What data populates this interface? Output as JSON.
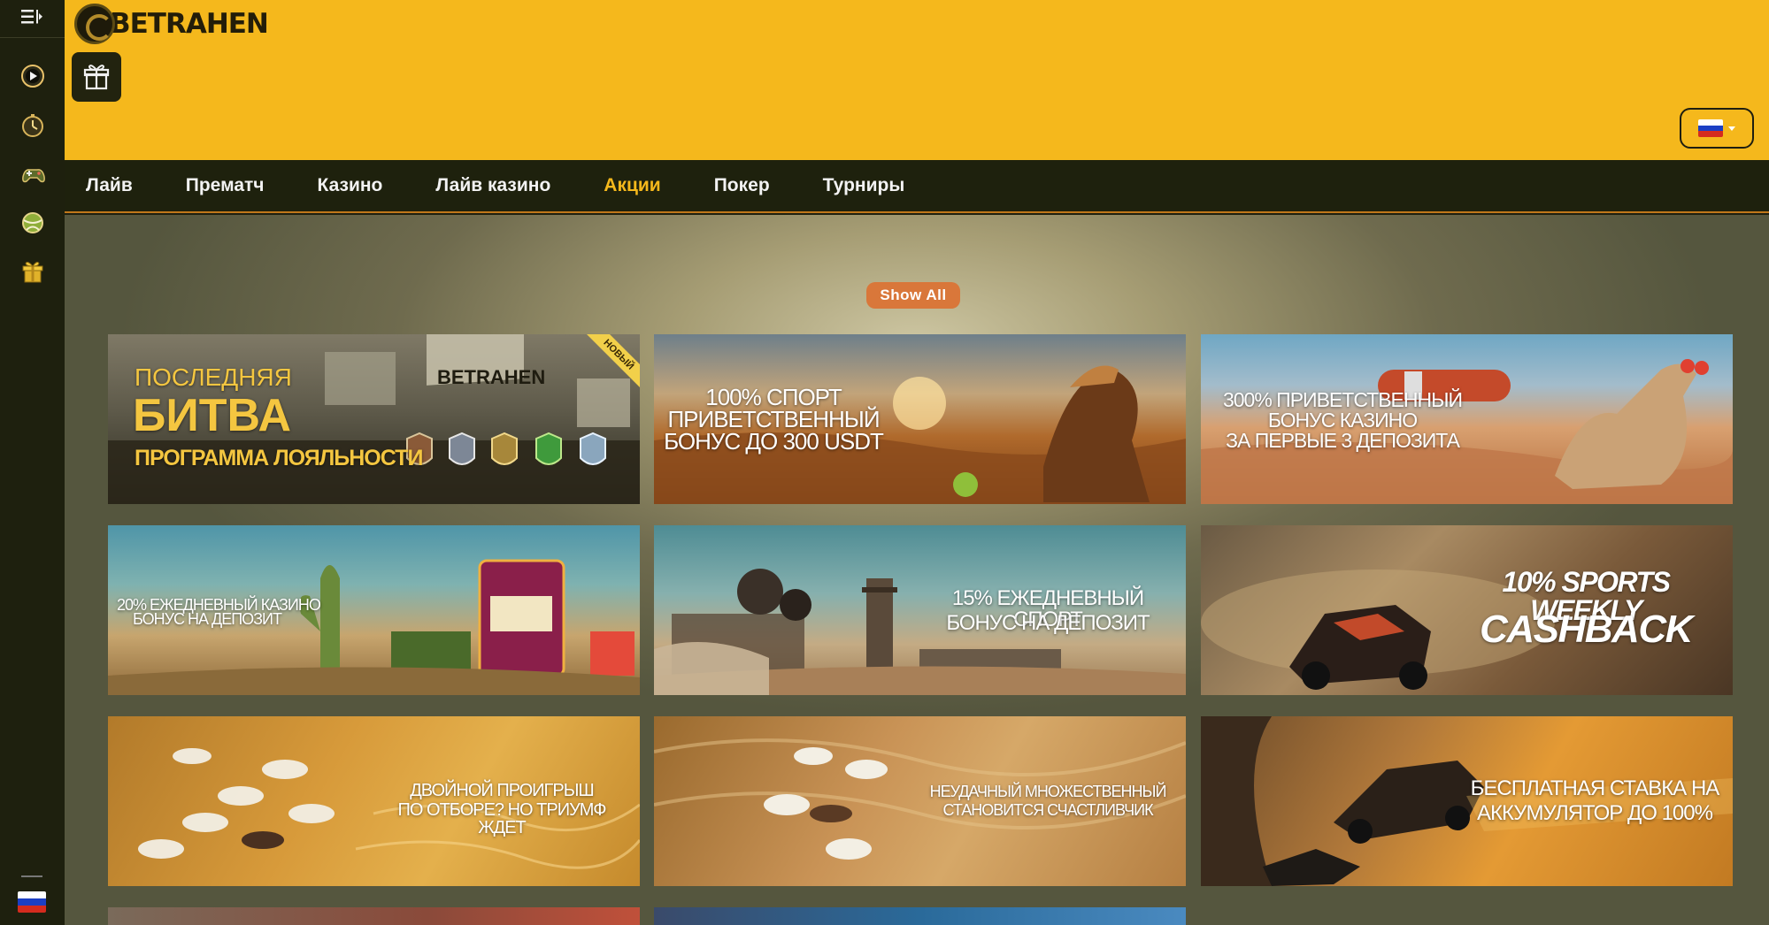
{
  "brand": {
    "logo_text": "BETRAHEN"
  },
  "sidebar": {
    "icons": [
      "live-play-icon",
      "stopwatch-icon",
      "game-controller-icon",
      "sports-ball-icon",
      "gift-icon"
    ],
    "language_flag": "ru-flag-icon"
  },
  "header": {
    "gift_icon": "gift-icon",
    "language": "ru"
  },
  "nav": {
    "items": [
      {
        "label": "Лайв"
      },
      {
        "label": "Прематч"
      },
      {
        "label": "Казино"
      },
      {
        "label": "Лайв казино"
      },
      {
        "label": "Акции",
        "active": true
      },
      {
        "label": "Покер"
      },
      {
        "label": "Турниры"
      }
    ]
  },
  "content": {
    "show_all_label": "Show All"
  },
  "promos": [
    {
      "line1": "ПОСЛЕДНЯЯ",
      "line2": "БИТВА",
      "line3": "ПРОГРАММА ЛОЯЛЬНОСТИ",
      "badge": "НОВЫЙ",
      "banner_text": "BETRAHEN"
    },
    {
      "line1": "100% СПОРТ",
      "line2": "ПРИВЕТСТВЕННЫЙ",
      "line3": "БОНУС ДО 300 USDT"
    },
    {
      "line1": "300% ПРИВЕТСТВЕННЫЙ",
      "line2": "БОНУС КАЗИНО",
      "line3": "ЗА ПЕРВЫЕ 3 ДЕПОЗИТА"
    },
    {
      "line1": "20% ЕЖЕДНЕВНЫЙ КАЗИНО",
      "line2": "БОНУС НА ДЕПОЗИТ"
    },
    {
      "line1": "15% ЕЖЕДНЕВНЫЙ СПОРТ",
      "line2": "БОНУС НА ДЕПОЗИТ"
    },
    {
      "line1": "10% SPORTS WEEKLY",
      "line2": "CASHBACK"
    },
    {
      "line1": "ДВОЙНОЙ ПРОИГРЫШ",
      "line2": "ПО ОТБОРЕ? НО ТРИУМФ ЖДЕТ"
    },
    {
      "line1": "НЕУДАЧНЫЙ МНОЖЕСТВЕННЫЙ",
      "line2": "СТАНОВИТСЯ СЧАСТЛИВЧИК"
    },
    {
      "line1": "БЕСПЛАТНАЯ СТАВКА НА",
      "line2": "АККУМУЛЯТОР ДО 100%"
    }
  ],
  "colors": {
    "header_bg": "#f5b81c",
    "nav_bg": "#1e210d",
    "active_nav": "#f5b81c",
    "show_all_bg": "#d9773a",
    "sidebar_bg": "#1e200e"
  }
}
